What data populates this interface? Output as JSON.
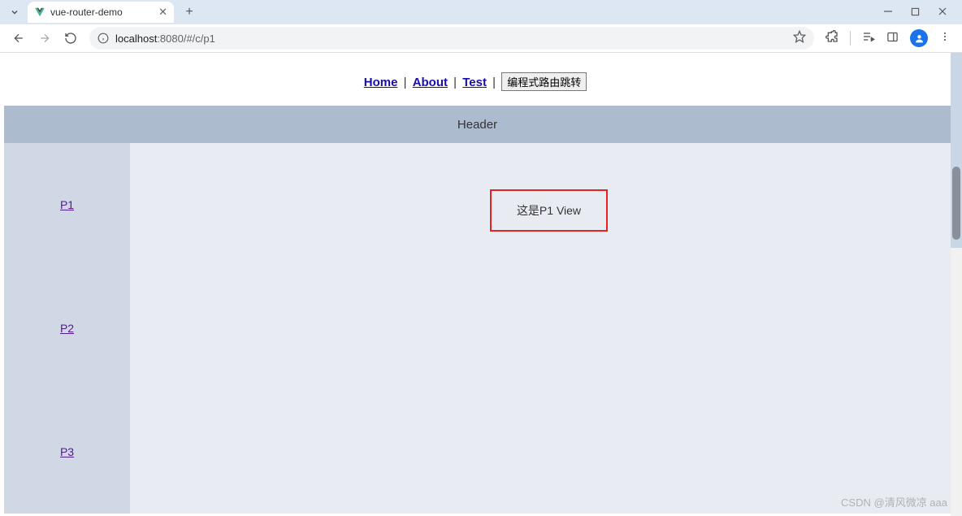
{
  "browser": {
    "tab_title": "vue-router-demo",
    "url_host": "localhost",
    "url_port_path": ":8080/#/c/p1"
  },
  "nav": {
    "home": "Home",
    "about": "About",
    "test": "Test",
    "sep": " | ",
    "button": "编程式路由跳转"
  },
  "app": {
    "header": "Header",
    "sidebar": {
      "p1": "P1",
      "p2": "P2",
      "p3": "P3"
    },
    "view_text": "这是P1 View"
  },
  "watermark": "CSDN @清风微凉 aaa"
}
